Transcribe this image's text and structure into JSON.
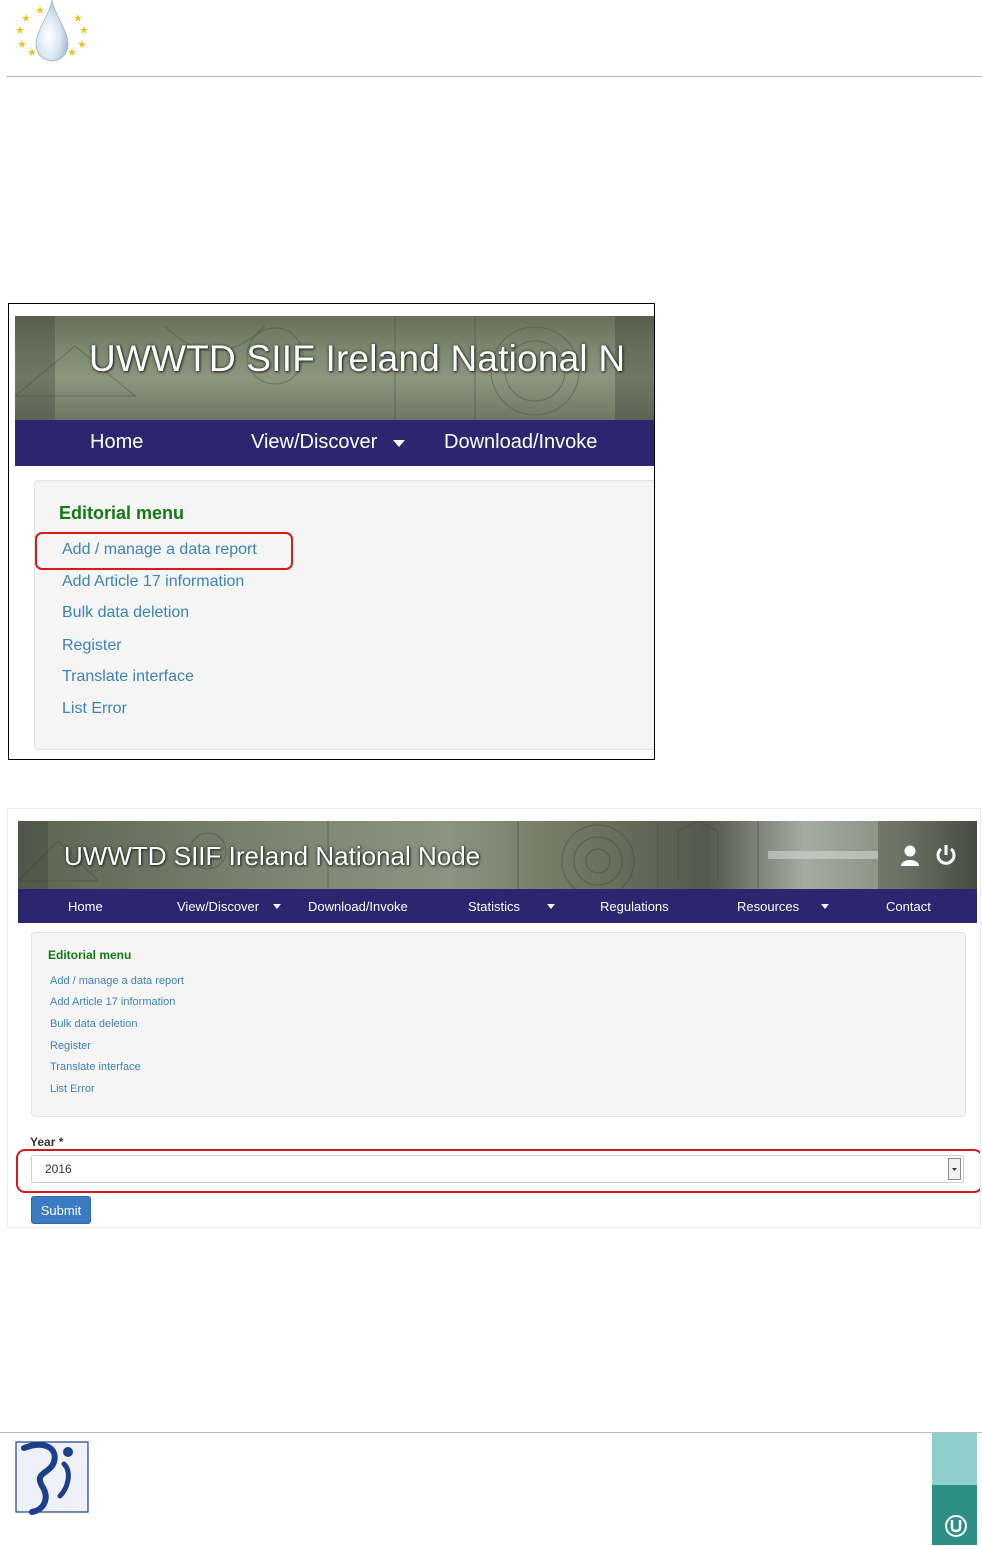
{
  "screenshot_zoomed": {
    "banner_title": "UWWTD SIIF Ireland National N",
    "nav": [
      "Home",
      "View/Discover",
      "Download/Invoke"
    ],
    "editorial_title": "Editorial menu",
    "menu_items": [
      "Add / manage a data report",
      "Add Article 17 information",
      "Bulk data deletion",
      "Register",
      "Translate interface",
      "List Error"
    ],
    "highlight_color": "#d7191c"
  },
  "screenshot_full": {
    "banner_title": "UWWTD SIIF Ireland National Node",
    "nav": [
      "Home",
      "View/Discover",
      "Download/Invoke",
      "Statistics",
      "Regulations",
      "Resources",
      "Contact"
    ],
    "editorial_title": "Editorial menu",
    "menu_items": [
      "Add / manage a data report",
      "Add Article 17 information",
      "Bulk data deletion",
      "Register",
      "Translate interface",
      "List Error"
    ],
    "year_label": "Year *",
    "year_value": "2016",
    "submit_label": "Submit"
  },
  "colors": {
    "nav_bg": "#2c2670",
    "link": "#3e82b4",
    "editorial_title": "#127a12",
    "submit_bg": "#3b7bc2"
  }
}
